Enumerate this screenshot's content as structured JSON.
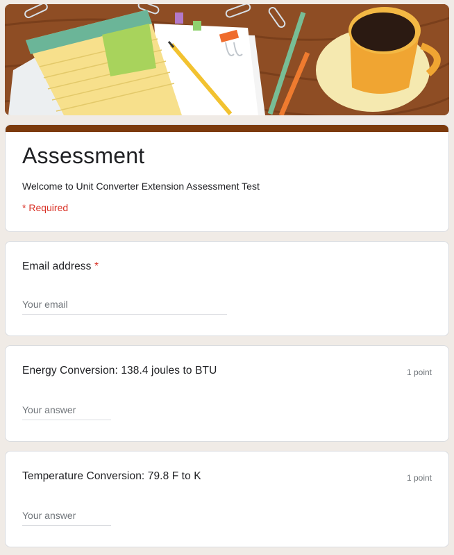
{
  "header": {
    "title": "Assessment",
    "description": "Welcome to Unit Converter Extension Assessment Test",
    "required_note": "* Required",
    "accent_color": "#7c3a0c",
    "banner_icons": [
      "paperclip-icon",
      "notepad-icon",
      "sticky-note-icon",
      "pencil-icon",
      "pen-icon",
      "coffee-cup-icon"
    ]
  },
  "questions": [
    {
      "title": "Email address",
      "required_marker": "*",
      "placeholder": "Your email"
    },
    {
      "title": "Energy Conversion: 138.4 joules to BTU",
      "points": "1 point",
      "placeholder": "Your answer"
    },
    {
      "title": "Temperature Conversion: 79.8 F to K",
      "points": "1 point",
      "placeholder": "Your answer"
    }
  ]
}
